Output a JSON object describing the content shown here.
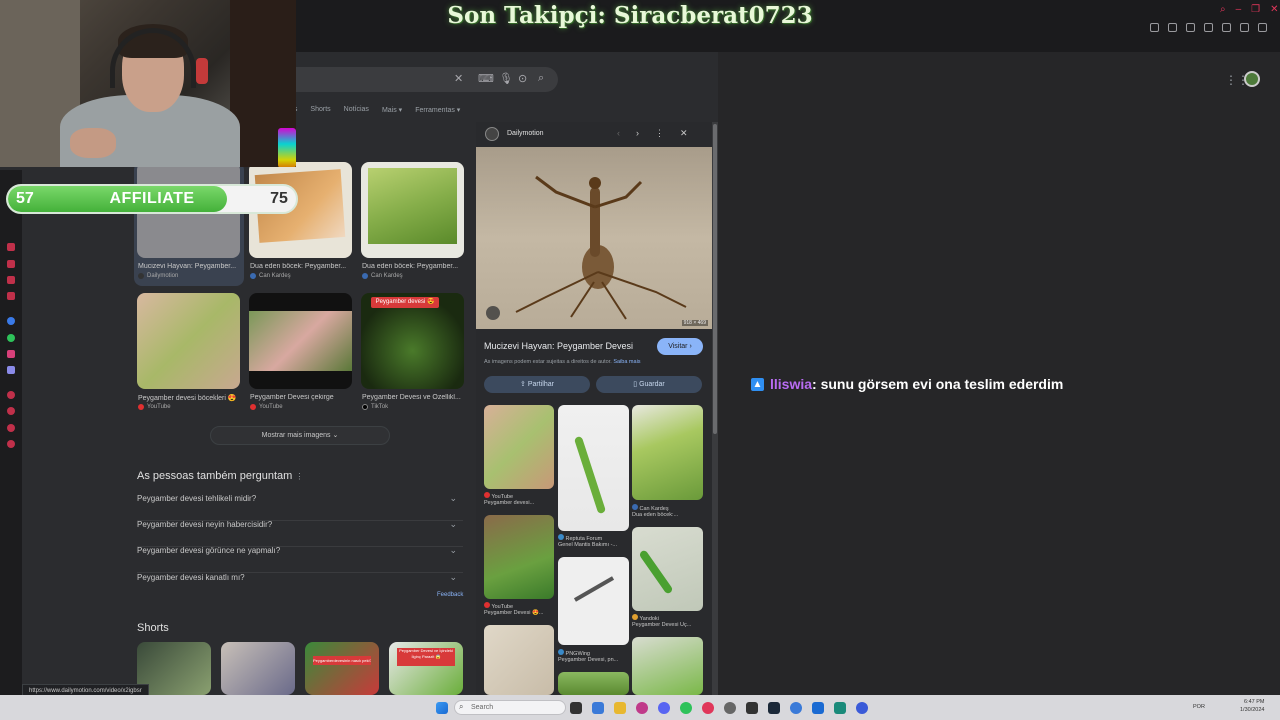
{
  "stream": {
    "follower_text": "Son Takipçi: Siracberat0723",
    "affiliate": {
      "current": "57",
      "label": "AFFILIATE",
      "target": "75",
      "progress": 0.76
    },
    "chat": {
      "badge_icon": "prime-icon",
      "user": "lliswia",
      "message": ": sunu görsem evi ona teslim ederdim"
    }
  },
  "search": {
    "tabs": [
      "Shorts",
      "Notícias",
      "Mais ▾",
      "Ferramentas ▾"
    ],
    "tabs_partial": "os",
    "images": [
      {
        "title": "Mucizevi Hayvan: Peygamber...",
        "source": "Dailymotion",
        "color": "#8a8a8e"
      },
      {
        "title": "Dua eden böcek: Peygamber...",
        "source": "Can Kardeş",
        "color": "#c2884a"
      },
      {
        "title": "Dua eden böcek: Peygamber...",
        "source": "Can Kardeş",
        "color": "#86ae4a"
      },
      {
        "title": "Peygamber devesi böcekleri 😍",
        "source": "YouTube",
        "color": "#a8b868"
      },
      {
        "title": "Peygamber Devesi çekirge",
        "source": "YouTube",
        "color": "#7a9858"
      },
      {
        "title": "Peygamber Devesi ve Özellikl...",
        "source": "TikTok",
        "color": "#2e4a1c"
      }
    ],
    "image_label_badge": "Peygamber devesi 😍",
    "more_images": "Mostrar mais imagens",
    "paa_title": "As pessoas também perguntam",
    "questions": [
      "Peygamber devesi tehlikeli midir?",
      "Peygamber devesi neyin habercisidir?",
      "Peygamber devesi görünce ne yapmalı?",
      "Peygamber devesi kanatlı mı?"
    ],
    "feedback": "Feedback",
    "shorts_title": "Shorts",
    "shorts_badges": [
      "Peygamberdevesinin nasılı peki?",
      "Peygamber Devesi ve İçindeki İlginç Parazit 😱"
    ]
  },
  "side_panel": {
    "source": "Dailymotion",
    "image_size": "918 × 469",
    "title": "Mucizevi Hayvan: Peygamber Devesi",
    "visit": "Visitar ›",
    "rights": "As imagens podem estar sujeitas a direitos de autor.",
    "learn_more": "Saiba mais",
    "share": "Partilhar",
    "save": "Guardar",
    "related": [
      {
        "source": "YouTube",
        "caption": "Peygamber devesi..."
      },
      {
        "source": "YouTube",
        "caption": "Peygamber Devesi 😍..."
      },
      {
        "source": "Reptuta Forum",
        "caption": "Genel Mantis Bakımı -..."
      },
      {
        "source": "PNGWing",
        "caption": "Peygamber Devesi, pn..."
      },
      {
        "source": "Can Kardeş",
        "caption": "Dua eden böcek:..."
      },
      {
        "source": "Yandoki",
        "caption": "Peygamber Devesi Uç..."
      }
    ]
  },
  "status_url": "https://www.dailymotion.com/video/x2igbsr",
  "taskbar": {
    "search_placeholder": "Search",
    "lang": "POR",
    "time": "6:47 PM",
    "date": "1/30/2024"
  }
}
